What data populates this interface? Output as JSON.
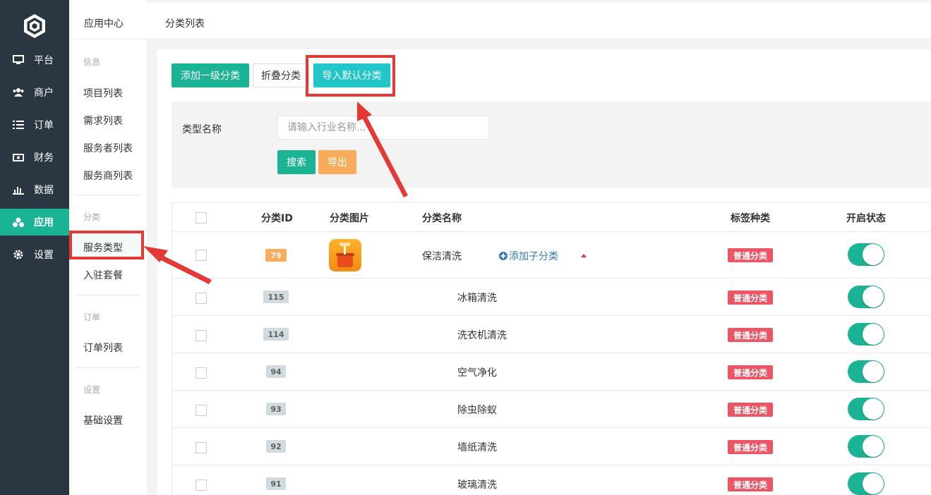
{
  "nav": {
    "items": [
      {
        "label": "平台",
        "icon": "monitor-icon"
      },
      {
        "label": "商户",
        "icon": "users-icon"
      },
      {
        "label": "订单",
        "icon": "list-icon"
      },
      {
        "label": "财务",
        "icon": "money-icon"
      },
      {
        "label": "数据",
        "icon": "bar-chart-icon"
      },
      {
        "label": "应用",
        "icon": "cubes-icon"
      },
      {
        "label": "设置",
        "icon": "gear-icon"
      }
    ],
    "active": "应用"
  },
  "subnav": {
    "title": "应用中心",
    "sections": [
      {
        "heading": "信息",
        "links": [
          "项目列表",
          "需求列表",
          "服务者列表",
          "服务商列表"
        ]
      },
      {
        "heading": "分类",
        "links": [
          "服务类型",
          "入驻套餐"
        ]
      },
      {
        "heading": "订单",
        "links": [
          "订单列表"
        ]
      },
      {
        "heading": "设置",
        "links": [
          "基础设置"
        ]
      }
    ],
    "active": "服务类型"
  },
  "breadcrumb": "分类列表",
  "toolbar": {
    "add_label": "添加一级分类",
    "fold_label": "折叠分类",
    "import_label": "导入默认分类"
  },
  "filter": {
    "label": "类型名称",
    "placeholder": "请输入行业名称...",
    "search_label": "搜索",
    "export_label": "导出"
  },
  "table": {
    "headers": [
      "分类ID",
      "分类图片",
      "分类名称",
      "标签种类",
      "开启状态"
    ],
    "add_sub_label": "添加子分类",
    "rows": [
      {
        "id": "79",
        "name": "保洁清洗",
        "tag": "普通分类",
        "enabled": true,
        "parent": true
      },
      {
        "id": "115",
        "name": "冰箱清洗",
        "tag": "普通分类",
        "enabled": true,
        "parent": false
      },
      {
        "id": "114",
        "name": "洗衣机清洗",
        "tag": "普通分类",
        "enabled": true,
        "parent": false
      },
      {
        "id": "94",
        "name": "空气净化",
        "tag": "普通分类",
        "enabled": true,
        "parent": false
      },
      {
        "id": "93",
        "name": "除虫除蚁",
        "tag": "普通分类",
        "enabled": true,
        "parent": false
      },
      {
        "id": "92",
        "name": "墙纸清洗",
        "tag": "普通分类",
        "enabled": true,
        "parent": false
      },
      {
        "id": "91",
        "name": "玻璃清洗",
        "tag": "普通分类",
        "enabled": true,
        "parent": false
      }
    ]
  },
  "colors": {
    "accent": "#1ab394",
    "nav_bg": "#2a3642",
    "tag_red": "#ed5565",
    "highlight": "#e53935"
  }
}
